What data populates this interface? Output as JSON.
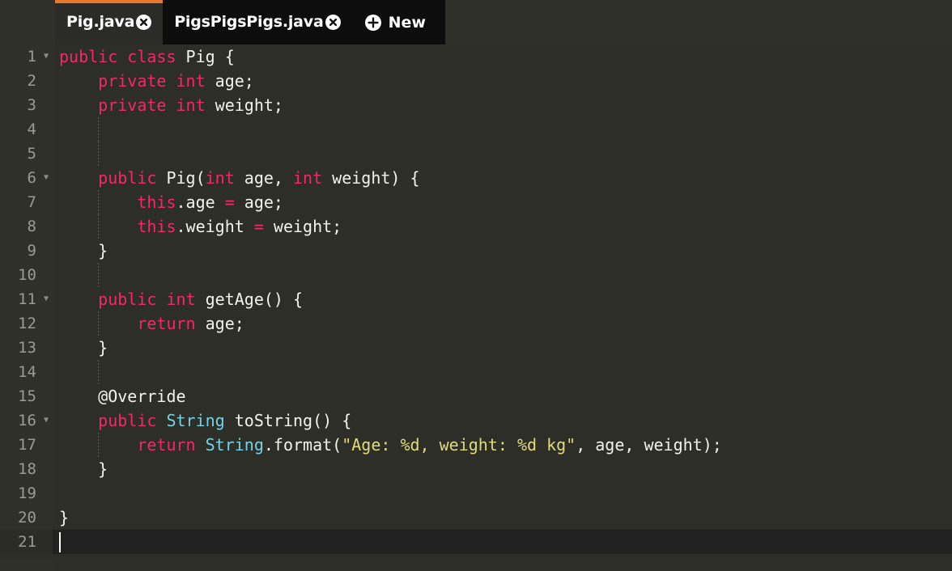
{
  "window": {
    "title": "Pig.java",
    "theme": "monokai-dark",
    "background": "#2d2e28",
    "gutter_background": "#2f302a",
    "active_line_background": "#212121",
    "active_tab_accent": "#e8762b"
  },
  "tab_bar": {
    "tabs": [
      {
        "label": "Pig.java",
        "active": true,
        "close_icon": "close-circle-icon"
      },
      {
        "label": "PigsPigsPigs.java",
        "active": false,
        "close_icon": "close-circle-icon"
      }
    ],
    "new_tab": {
      "label": "New",
      "icon": "plus-circle-icon"
    }
  },
  "editor": {
    "language": "java",
    "cursor_line": 21,
    "cursor_column": 1,
    "total_lines": 21,
    "colors": {
      "keyword": "#f6266e",
      "type": "#74d2e7",
      "annotation": "#74d2e7",
      "string": "#e1d97a",
      "plain": "#f3f3ee",
      "line_number": "#9a9b93"
    },
    "lines": [
      {
        "n": "1",
        "fold": true,
        "indent": 0,
        "active": false,
        "tokens": [
          {
            "t": "public",
            "c": "keyword"
          },
          {
            "t": " ",
            "c": "plain"
          },
          {
            "t": "class",
            "c": "keyword"
          },
          {
            "t": " Pig {",
            "c": "plain"
          }
        ]
      },
      {
        "n": "2",
        "fold": false,
        "indent": 0,
        "active": false,
        "tokens": [
          {
            "t": "    ",
            "c": "plain"
          },
          {
            "t": "private",
            "c": "keyword"
          },
          {
            "t": " ",
            "c": "plain"
          },
          {
            "t": "int",
            "c": "keyword"
          },
          {
            "t": " age;",
            "c": "plain"
          }
        ]
      },
      {
        "n": "3",
        "fold": false,
        "indent": 0,
        "active": false,
        "tokens": [
          {
            "t": "    ",
            "c": "plain"
          },
          {
            "t": "private",
            "c": "keyword"
          },
          {
            "t": " ",
            "c": "plain"
          },
          {
            "t": "int",
            "c": "keyword"
          },
          {
            "t": " weight;",
            "c": "plain"
          }
        ]
      },
      {
        "n": "4",
        "fold": false,
        "indent": 1,
        "active": false,
        "tokens": []
      },
      {
        "n": "5",
        "fold": false,
        "indent": 1,
        "active": false,
        "tokens": []
      },
      {
        "n": "6",
        "fold": true,
        "indent": 0,
        "active": false,
        "tokens": [
          {
            "t": "    ",
            "c": "plain"
          },
          {
            "t": "public",
            "c": "keyword"
          },
          {
            "t": " Pig(",
            "c": "plain"
          },
          {
            "t": "int",
            "c": "keyword"
          },
          {
            "t": " age, ",
            "c": "plain"
          },
          {
            "t": "int",
            "c": "keyword"
          },
          {
            "t": " weight) {",
            "c": "plain"
          }
        ]
      },
      {
        "n": "7",
        "fold": false,
        "indent": 1,
        "active": false,
        "tokens": [
          {
            "t": "        ",
            "c": "plain"
          },
          {
            "t": "this",
            "c": "keyword"
          },
          {
            "t": ".age ",
            "c": "plain"
          },
          {
            "t": "=",
            "c": "keyword"
          },
          {
            "t": " age;",
            "c": "plain"
          }
        ]
      },
      {
        "n": "8",
        "fold": false,
        "indent": 1,
        "active": false,
        "tokens": [
          {
            "t": "        ",
            "c": "plain"
          },
          {
            "t": "this",
            "c": "keyword"
          },
          {
            "t": ".weight ",
            "c": "plain"
          },
          {
            "t": "=",
            "c": "keyword"
          },
          {
            "t": " weight;",
            "c": "plain"
          }
        ]
      },
      {
        "n": "9",
        "fold": false,
        "indent": 0,
        "active": false,
        "tokens": [
          {
            "t": "    }",
            "c": "plain"
          }
        ]
      },
      {
        "n": "10",
        "fold": false,
        "indent": 1,
        "active": false,
        "tokens": []
      },
      {
        "n": "11",
        "fold": true,
        "indent": 0,
        "active": false,
        "tokens": [
          {
            "t": "    ",
            "c": "plain"
          },
          {
            "t": "public",
            "c": "keyword"
          },
          {
            "t": " ",
            "c": "plain"
          },
          {
            "t": "int",
            "c": "keyword"
          },
          {
            "t": " getAge() {",
            "c": "plain"
          }
        ]
      },
      {
        "n": "12",
        "fold": false,
        "indent": 1,
        "active": false,
        "tokens": [
          {
            "t": "        ",
            "c": "plain"
          },
          {
            "t": "return",
            "c": "keyword"
          },
          {
            "t": " age;",
            "c": "plain"
          }
        ]
      },
      {
        "n": "13",
        "fold": false,
        "indent": 0,
        "active": false,
        "tokens": [
          {
            "t": "    }",
            "c": "plain"
          }
        ]
      },
      {
        "n": "14",
        "fold": false,
        "indent": 1,
        "active": false,
        "tokens": []
      },
      {
        "n": "15",
        "fold": false,
        "indent": 0,
        "active": false,
        "tokens": [
          {
            "t": "    ",
            "c": "plain"
          },
          {
            "t": "@Override",
            "c": "annotation"
          }
        ]
      },
      {
        "n": "16",
        "fold": true,
        "indent": 0,
        "active": false,
        "tokens": [
          {
            "t": "    ",
            "c": "plain"
          },
          {
            "t": "public",
            "c": "keyword"
          },
          {
            "t": " ",
            "c": "plain"
          },
          {
            "t": "String",
            "c": "type"
          },
          {
            "t": " toString() {",
            "c": "plain"
          }
        ]
      },
      {
        "n": "17",
        "fold": false,
        "indent": 1,
        "active": false,
        "tokens": [
          {
            "t": "        ",
            "c": "plain"
          },
          {
            "t": "return",
            "c": "keyword"
          },
          {
            "t": " ",
            "c": "plain"
          },
          {
            "t": "String",
            "c": "type"
          },
          {
            "t": ".format(",
            "c": "plain"
          },
          {
            "t": "\"Age: %d, weight: %d kg\"",
            "c": "string"
          },
          {
            "t": ", age, weight);",
            "c": "plain"
          }
        ]
      },
      {
        "n": "18",
        "fold": false,
        "indent": 0,
        "active": false,
        "tokens": [
          {
            "t": "    }",
            "c": "plain"
          }
        ]
      },
      {
        "n": "19",
        "fold": false,
        "indent": 0,
        "active": false,
        "tokens": []
      },
      {
        "n": "20",
        "fold": false,
        "indent": 0,
        "active": false,
        "tokens": [
          {
            "t": "}",
            "c": "plain"
          }
        ]
      },
      {
        "n": "21",
        "fold": false,
        "indent": 0,
        "active": true,
        "caret": true,
        "tokens": []
      }
    ]
  }
}
